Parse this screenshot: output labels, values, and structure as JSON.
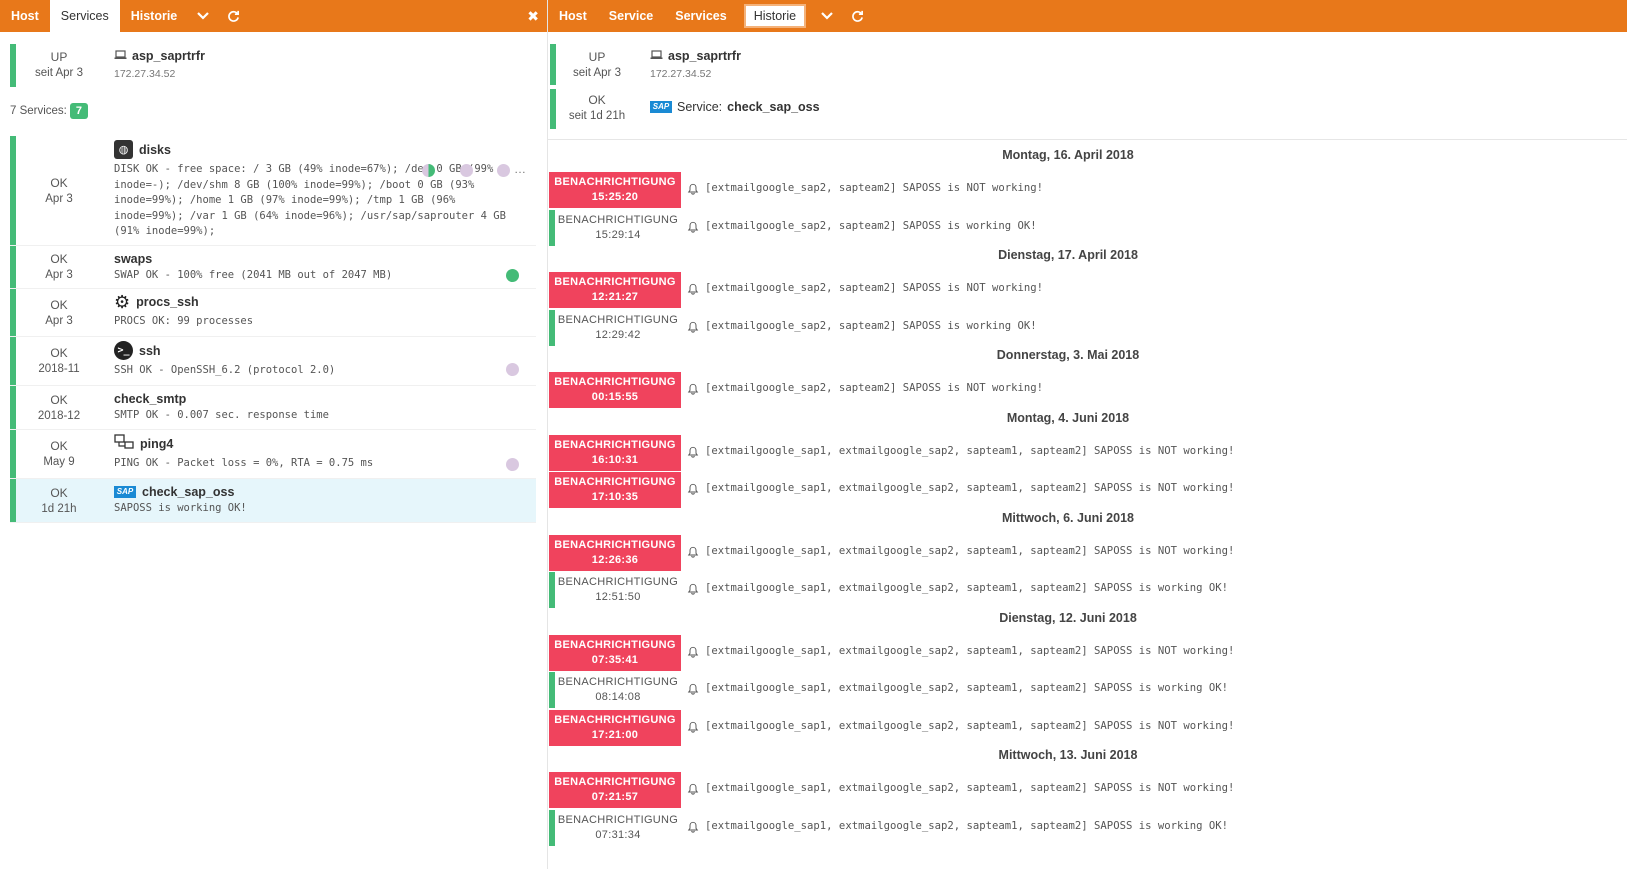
{
  "left": {
    "tabs": {
      "host": "Host",
      "services": "Services",
      "history": "Historie"
    },
    "host": {
      "state": "UP",
      "since": "seit Apr 3",
      "name": "asp_saprtrfr",
      "address": "172.27.34.52"
    },
    "services_label": "7 Services:",
    "services_count": "7",
    "services": [
      {
        "state": "OK",
        "since": "Apr 3",
        "name": "disks",
        "icon": "disk-icon",
        "output": "DISK OK - free space: / 3 GB (49% inode=67%); /dev 0 GB (99% inode=-); /dev/shm 8 GB (100% inode=99%); /boot 0 GB (93% inode=99%); /home 1 GB (97% inode=99%); /tmp 1 GB (96% inode=99%); /var 1 GB (64% inode=96%); /usr/sap/saprouter 4 GB (91% inode=99%);"
      },
      {
        "state": "OK",
        "since": "Apr 3",
        "name": "swaps",
        "icon": "none",
        "output": "SWAP OK - 100% free (2041 MB out of 2047 MB)"
      },
      {
        "state": "OK",
        "since": "Apr 3",
        "name": "procs_ssh",
        "icon": "gears-icon",
        "output": "PROCS OK: 99 processes"
      },
      {
        "state": "OK",
        "since": "2018-11",
        "name": "ssh",
        "icon": "terminal-icon",
        "output": "SSH OK - OpenSSH_6.2 (protocol 2.0)"
      },
      {
        "state": "OK",
        "since": "2018-12",
        "name": "check_smtp",
        "icon": "none",
        "output": "SMTP OK - 0.007 sec. response time"
      },
      {
        "state": "OK",
        "since": "May 9",
        "name": "ping4",
        "icon": "network-icon",
        "output": "PING OK - Packet loss = 0%, RTA = 0.75 ms"
      },
      {
        "state": "OK",
        "since": "1d 21h",
        "name": "check_sap_oss",
        "icon": "sap-icon",
        "output": "SAPOSS is working OK!"
      }
    ]
  },
  "right": {
    "tabs": {
      "host": "Host",
      "service": "Service",
      "services": "Services",
      "history": "Historie"
    },
    "host": {
      "state": "UP",
      "since": "seit Apr 3",
      "name": "asp_saprtrfr",
      "address": "172.27.34.52"
    },
    "service": {
      "state": "OK",
      "since": "seit 1d 21h",
      "prefix": "Service:",
      "name": "check_sap_oss",
      "logo_text": "SAP"
    },
    "days": [
      {
        "label": "Montag, 16. April 2018",
        "events": [
          {
            "type": "crit",
            "label": "BENACHRICHTIGUNG",
            "time": "15:25:20",
            "msg": "[extmailgoogle_sap2, sapteam2] SAPOSS is NOT working!"
          },
          {
            "type": "ok",
            "label": "BENACHRICHTIGUNG",
            "time": "15:29:14",
            "msg": "[extmailgoogle_sap2, sapteam2] SAPOSS is working OK!"
          }
        ]
      },
      {
        "label": "Dienstag, 17. April 2018",
        "events": [
          {
            "type": "crit",
            "label": "BENACHRICHTIGUNG",
            "time": "12:21:27",
            "msg": "[extmailgoogle_sap2, sapteam2] SAPOSS is NOT working!"
          },
          {
            "type": "ok",
            "label": "BENACHRICHTIGUNG",
            "time": "12:29:42",
            "msg": "[extmailgoogle_sap2, sapteam2] SAPOSS is working OK!"
          }
        ]
      },
      {
        "label": "Donnerstag, 3. Mai 2018",
        "events": [
          {
            "type": "crit",
            "label": "BENACHRICHTIGUNG",
            "time": "00:15:55",
            "msg": "[extmailgoogle_sap2, sapteam2] SAPOSS is NOT working!"
          }
        ]
      },
      {
        "label": "Montag, 4. Juni 2018",
        "events": [
          {
            "type": "crit",
            "label": "BENACHRICHTIGUNG",
            "time": "16:10:31",
            "msg": "[extmailgoogle_sap1, extmailgoogle_sap2, sapteam1, sapteam2] SAPOSS is NOT working!"
          },
          {
            "type": "crit",
            "label": "BENACHRICHTIGUNG",
            "time": "17:10:35",
            "msg": "[extmailgoogle_sap1, extmailgoogle_sap2, sapteam1, sapteam2] SAPOSS is NOT working!"
          }
        ]
      },
      {
        "label": "Mittwoch, 6. Juni 2018",
        "events": [
          {
            "type": "crit",
            "label": "BENACHRICHTIGUNG",
            "time": "12:26:36",
            "msg": "[extmailgoogle_sap1, extmailgoogle_sap2, sapteam1, sapteam2] SAPOSS is NOT working!"
          },
          {
            "type": "ok",
            "label": "BENACHRICHTIGUNG",
            "time": "12:51:50",
            "msg": "[extmailgoogle_sap1, extmailgoogle_sap2, sapteam1, sapteam2] SAPOSS is working OK!"
          }
        ]
      },
      {
        "label": "Dienstag, 12. Juni 2018",
        "events": [
          {
            "type": "crit",
            "label": "BENACHRICHTIGUNG",
            "time": "07:35:41",
            "msg": "[extmailgoogle_sap1, extmailgoogle_sap2, sapteam1, sapteam2] SAPOSS is NOT working!"
          },
          {
            "type": "ok",
            "label": "BENACHRICHTIGUNG",
            "time": "08:14:08",
            "msg": "[extmailgoogle_sap1, extmailgoogle_sap2, sapteam1, sapteam2] SAPOSS is working OK!"
          },
          {
            "type": "crit",
            "label": "BENACHRICHTIGUNG",
            "time": "17:21:00",
            "msg": "[extmailgoogle_sap1, extmailgoogle_sap2, sapteam1, sapteam2] SAPOSS is NOT working!"
          }
        ]
      },
      {
        "label": "Mittwoch, 13. Juni 2018",
        "events": [
          {
            "type": "crit",
            "label": "BENACHRICHTIGUNG",
            "time": "07:21:57",
            "msg": "[extmailgoogle_sap1, extmailgoogle_sap2, sapteam1, sapteam2] SAPOSS is NOT working!"
          },
          {
            "type": "ok",
            "label": "BENACHRICHTIGUNG",
            "time": "07:31:34",
            "msg": "[extmailgoogle_sap1, extmailgoogle_sap2, sapteam1, sapteam2] SAPOSS is working OK!"
          }
        ]
      }
    ]
  },
  "colors": {
    "accent": "#e8781a",
    "ok": "#44bb77",
    "critical": "#f0435d",
    "selected": "#e6f6fb"
  }
}
